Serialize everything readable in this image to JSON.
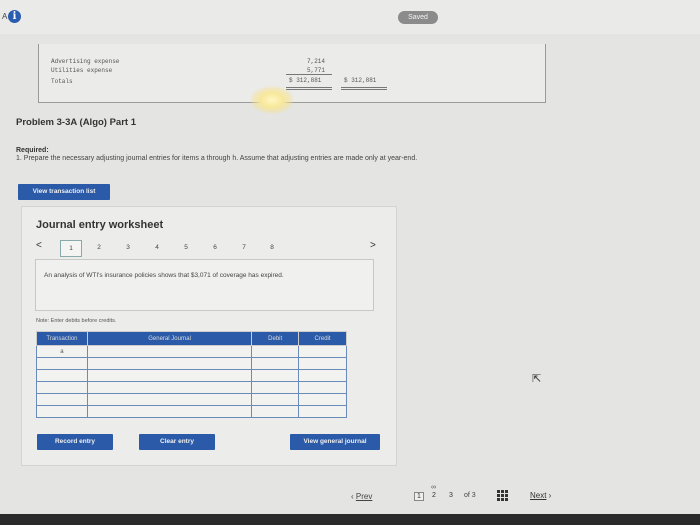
{
  "topbar": {
    "alpha_label": "A",
    "info_icon": "i",
    "saved_label": "Saved"
  },
  "summary": {
    "rows": [
      {
        "label": "Advertising expense",
        "value": "7,214"
      },
      {
        "label": "Utilities expense",
        "value": "5,771"
      },
      {
        "label": "Totals",
        "value": "$ 312,881",
        "value2": "$ 312,881"
      }
    ]
  },
  "problem": {
    "title": "Problem 3-3A (Algo) Part 1",
    "required_label": "Required:",
    "required_text": "1. Prepare the necessary adjusting journal entries for items a through h. Assume that adjusting entries are made only at year-end."
  },
  "buttons": {
    "view_transaction_list": "View transaction list",
    "record_entry": "Record entry",
    "clear_entry": "Clear entry",
    "view_general_journal": "View general journal"
  },
  "worksheet": {
    "title": "Journal entry worksheet",
    "prev": "<",
    "next": ">",
    "tabs": [
      "1",
      "2",
      "3",
      "4",
      "5",
      "6",
      "7",
      "8"
    ],
    "active_tab": "1",
    "description": "An analysis of WTI's insurance policies shows that $3,071 of coverage has expired.",
    "note": "Note: Enter debits before credits."
  },
  "journal_table": {
    "headers": [
      "Transaction",
      "General Journal",
      "Debit",
      "Credit"
    ],
    "first_transaction": "a"
  },
  "pager": {
    "prev": "Prev",
    "pages": [
      "1",
      "2",
      "3"
    ],
    "current": "1",
    "of_text": "of 3",
    "next": "Next"
  },
  "icons": {
    "info": "info-icon",
    "link": "link-icon",
    "grid": "grid-icon",
    "cursor": "mouse-cursor-icon"
  }
}
